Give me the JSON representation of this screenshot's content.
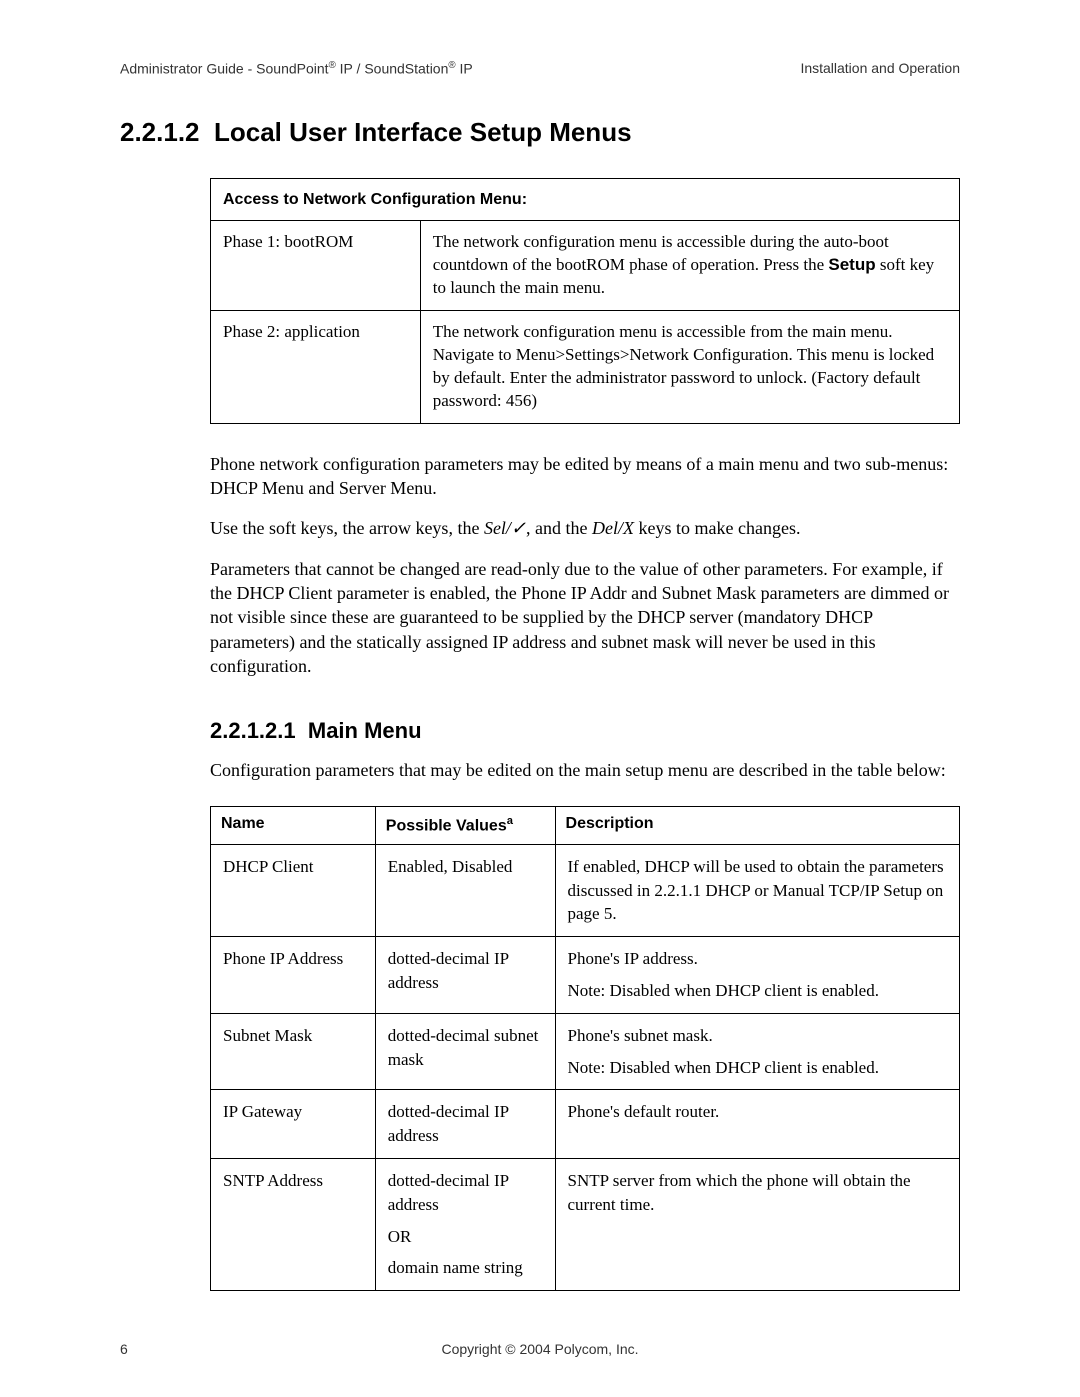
{
  "header": {
    "left_prefix": "Administrator Guide - SoundPoint",
    "left_mid": " IP / SoundStation",
    "left_suffix": " IP",
    "right": "Installation and Operation"
  },
  "section": {
    "number": "2.2.1.2",
    "title": "Local User Interface Setup Menus"
  },
  "access_table": {
    "title": "Access to Network Configuration Menu:",
    "rows": [
      {
        "phase": "Phase 1: bootROM",
        "desc_pre": "The network configuration menu is accessible during the auto-boot countdown of the bootROM phase of operation.  Press the ",
        "desc_bold": "Setup",
        "desc_post": " soft key to launch the main menu."
      },
      {
        "phase": "Phase 2: application",
        "desc": "The network configuration menu is accessible from the main menu. Navigate to Menu>Settings>Network Configuration.  This menu is locked by default.  Enter the administrator password to unlock. (Factory default password: 456)"
      }
    ]
  },
  "paragraphs": {
    "p1": "Phone network configuration parameters may be edited by means of a main menu and two sub-menus: DHCP Menu and Server Menu.",
    "p2_a": "Use the soft keys, the arrow keys, the ",
    "p2_sel": "Sel/✓",
    "p2_b": ", and the ",
    "p2_del": "Del/X",
    "p2_c": " keys to make changes.",
    "p3": "Parameters that cannot be changed are read-only due to the value of other parameters. For example, if the DHCP Client parameter is enabled, the Phone IP Addr and Subnet Mask parameters are dimmed or not visible since these are guaranteed to be supplied by the DHCP server (mandatory DHCP parameters) and the statically assigned IP address and subnet mask will never be used in this configuration."
  },
  "subsection": {
    "number": "2.2.1.2.1",
    "title": "Main Menu",
    "intro": "Configuration parameters that may be edited on the main setup menu are described in the table below:"
  },
  "params_table": {
    "headers": {
      "name": "Name",
      "values": "Possible Values",
      "values_sup": "a",
      "desc": "Description"
    },
    "rows": [
      {
        "name": "DHCP Client",
        "values": [
          "Enabled, Disabled"
        ],
        "desc": [
          "If enabled, DHCP will be used to obtain the parameters discussed in 2.2.1.1 DHCP or Manual TCP/IP Setup on page 5."
        ]
      },
      {
        "name": "Phone IP Address",
        "values": [
          "dotted-decimal IP address"
        ],
        "desc": [
          "Phone's IP address.",
          "Note: Disabled when DHCP client is enabled."
        ]
      },
      {
        "name": "Subnet Mask",
        "values": [
          "dotted-decimal subnet mask"
        ],
        "desc": [
          "Phone's subnet mask.",
          "Note: Disabled when DHCP client is enabled."
        ]
      },
      {
        "name": "IP Gateway",
        "values": [
          "dotted-decimal IP address"
        ],
        "desc": [
          "Phone's default router."
        ]
      },
      {
        "name": "SNTP Address",
        "values": [
          "dotted-decimal IP address",
          "OR",
          "domain name string"
        ],
        "desc": [
          "SNTP server from which the phone will obtain the current time."
        ]
      }
    ]
  },
  "footer": {
    "page": "6",
    "copyright": "Copyright © 2004 Polycom, Inc."
  }
}
